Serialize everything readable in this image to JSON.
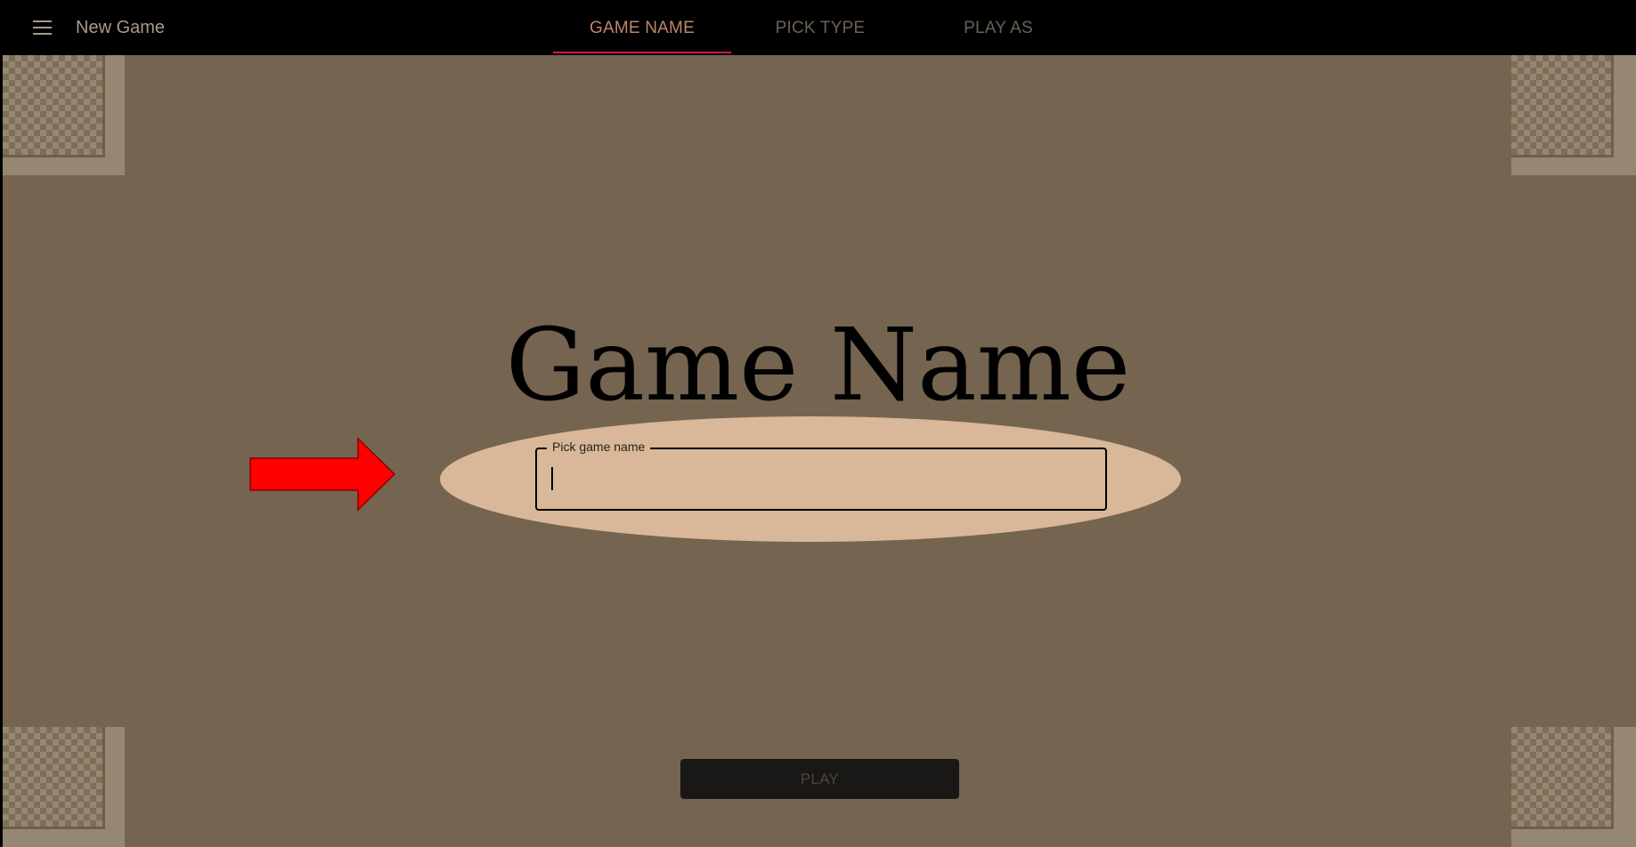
{
  "header": {
    "title": "New Game",
    "menu_icon": "hamburger-menu-icon"
  },
  "tabs": [
    {
      "label": "GAME NAME",
      "active": true
    },
    {
      "label": "PICK TYPE",
      "active": false
    },
    {
      "label": "PLAY AS",
      "active": false
    }
  ],
  "main": {
    "heading": "Game Name",
    "input": {
      "label": "Pick game name",
      "value": "",
      "placeholder": ""
    },
    "arrow_icon": "arrow-right-icon",
    "play_label": "PLAY"
  },
  "colors": {
    "background": "#756450",
    "topbar": "#000000",
    "tab_active": "#c0856a",
    "tab_indicator": "#d11a4f",
    "ellipse": "#d8b898",
    "arrow": "#ff0000",
    "play_button": "#1a1816"
  }
}
